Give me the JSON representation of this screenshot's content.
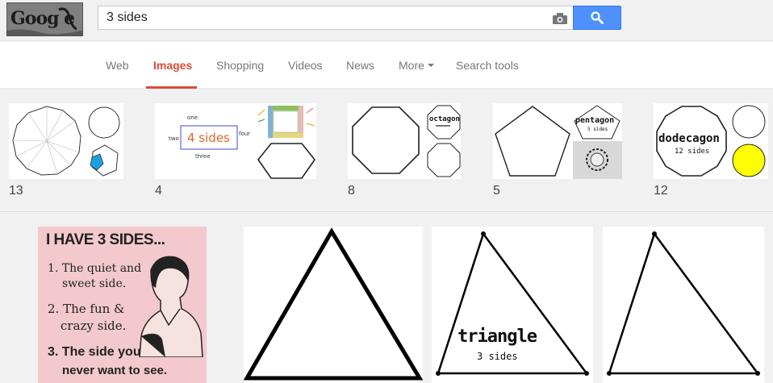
{
  "header": {
    "logo_text": "Goog e",
    "search": {
      "value": "3 sides",
      "placeholder": ""
    },
    "icons": {
      "camera": "camera-icon",
      "search": "magnifier-icon"
    }
  },
  "nav": {
    "items": [
      {
        "label": "Web",
        "active": false
      },
      {
        "label": "Images",
        "active": true
      },
      {
        "label": "Shopping",
        "active": false
      },
      {
        "label": "Videos",
        "active": false
      },
      {
        "label": "News",
        "active": false
      },
      {
        "label": "More",
        "active": false,
        "has_dropdown": true
      },
      {
        "label": "Search tools",
        "active": false
      }
    ]
  },
  "related": [
    {
      "count": "13",
      "texts": []
    },
    {
      "count": "4",
      "texts": [
        "one",
        "two",
        "4 sides",
        "four",
        "three"
      ]
    },
    {
      "count": "8",
      "texts": [
        "octagon"
      ]
    },
    {
      "count": "5",
      "texts": [
        "pentagon",
        "5 sides"
      ]
    },
    {
      "count": "12",
      "texts": [
        "dodecagon",
        "12 sides"
      ]
    }
  ],
  "results": {
    "poster": {
      "heading": "I HAVE 3 SIDES...",
      "lines": [
        "1. The quiet and",
        "sweet side.",
        "2. The fun &",
        "crazy side.",
        "3. The side you",
        "never want to see."
      ]
    },
    "triangle_labeled": {
      "label": "triangle",
      "sublabel": "3 sides"
    }
  },
  "colors": {
    "accent_red": "#dd4b39",
    "search_blue": "#4d90fe",
    "poster_pink": "#f3c9cd"
  }
}
